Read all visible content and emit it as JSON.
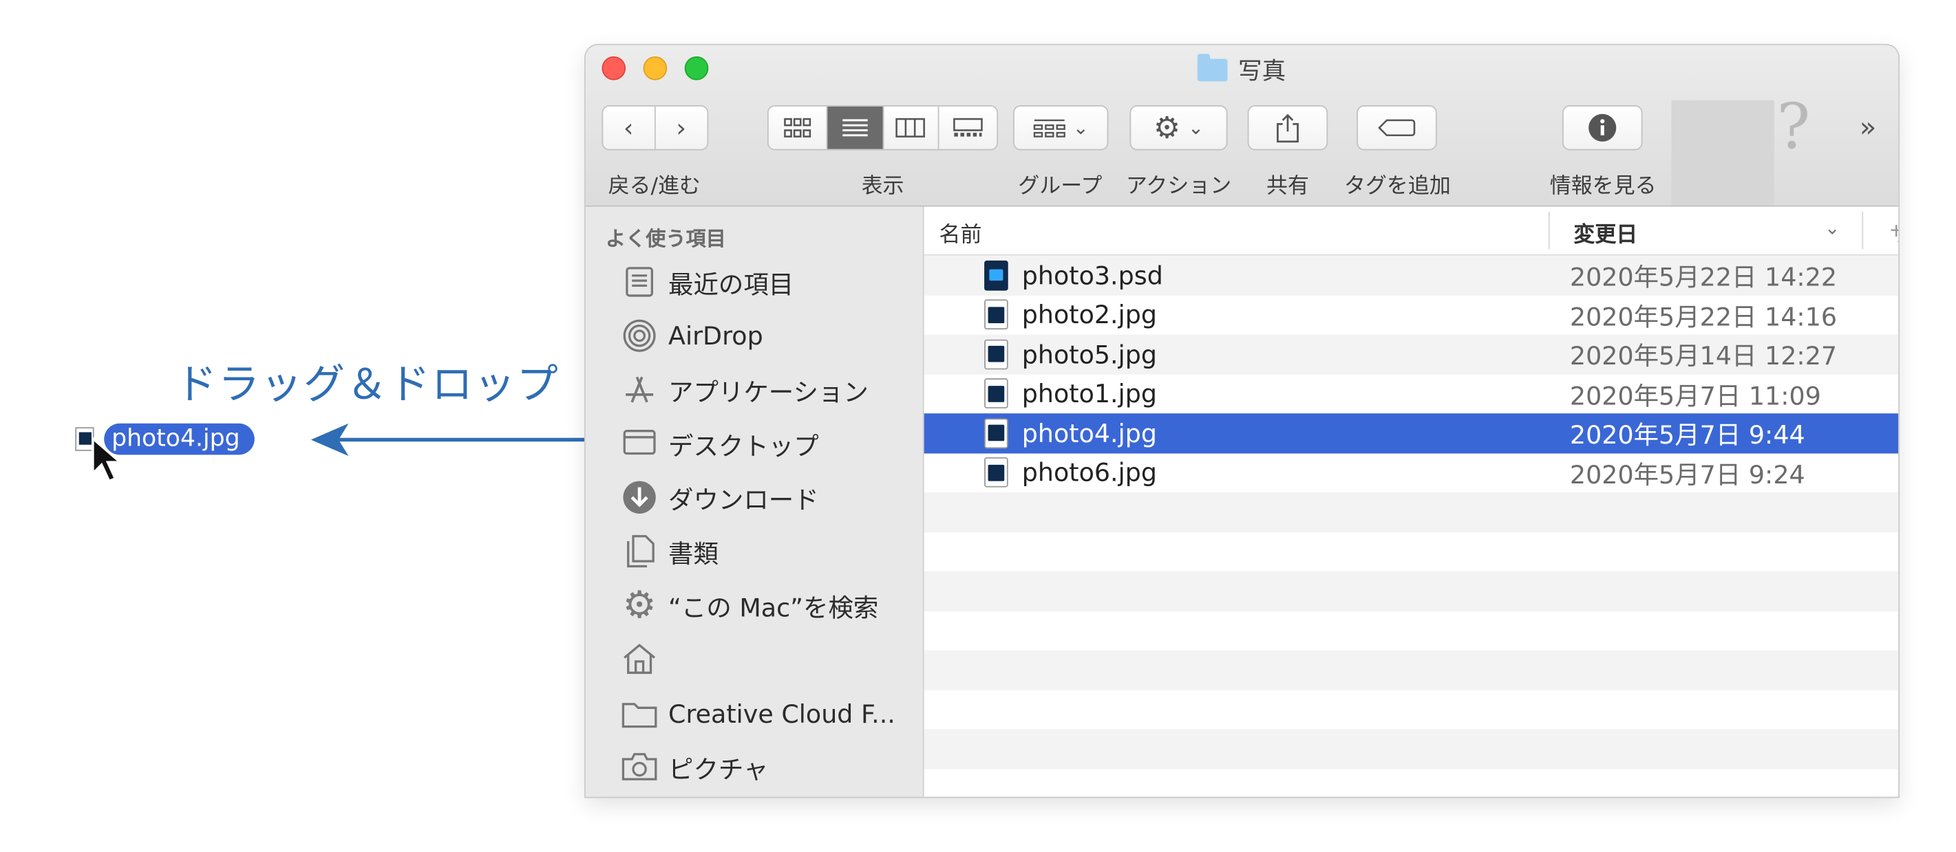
{
  "window": {
    "title": "写真",
    "toolbar": {
      "nav_label": "戻る/進む",
      "view_label": "表示",
      "group_label": "グループ",
      "action_label": "アクション",
      "share_label": "共有",
      "tag_label": "タグを追加",
      "info_label": "情報を見る",
      "back_glyph": "‹",
      "forward_glyph": "›",
      "more_glyph": "»",
      "help_glyph": "?"
    },
    "sidebar": {
      "header": "よく使う項目",
      "items": [
        {
          "label": "最近の項目",
          "icon": "recents-icon"
        },
        {
          "label": "AirDrop",
          "icon": "airdrop-icon"
        },
        {
          "label": "アプリケーション",
          "icon": "applications-icon"
        },
        {
          "label": "デスクトップ",
          "icon": "desktop-icon"
        },
        {
          "label": "ダウンロード",
          "icon": "downloads-icon"
        },
        {
          "label": "書類",
          "icon": "documents-icon"
        },
        {
          "label": "“この Mac”を検索",
          "icon": "gear-icon"
        },
        {
          "label": "",
          "icon": "home-icon"
        },
        {
          "label": "Creative Cloud F...",
          "icon": "folder-icon"
        },
        {
          "label": "ピクチャ",
          "icon": "camera-icon"
        }
      ]
    },
    "list": {
      "col_name": "名前",
      "col_date": "変更日",
      "col_extra": "サ",
      "files": [
        {
          "name": "photo3.psd",
          "date": "2020年5月22日 14:22",
          "type": "psd"
        },
        {
          "name": "photo2.jpg",
          "date": "2020年5月22日 14:16",
          "type": "jpg"
        },
        {
          "name": "photo5.jpg",
          "date": "2020年5月14日 12:27",
          "type": "jpg"
        },
        {
          "name": "photo1.jpg",
          "date": "2020年5月7日 11:09",
          "type": "jpg"
        },
        {
          "name": "photo4.jpg",
          "date": "2020年5月7日 9:44",
          "type": "jpg",
          "selected": true
        },
        {
          "name": "photo6.jpg",
          "date": "2020年5月7日 9:24",
          "type": "jpg"
        }
      ]
    }
  },
  "drag": {
    "label": "ドラッグ＆ドロップ",
    "ghost_name": "photo4.jpg"
  },
  "colors": {
    "selection": "#3a67d6",
    "annotation": "#2f6db4"
  }
}
